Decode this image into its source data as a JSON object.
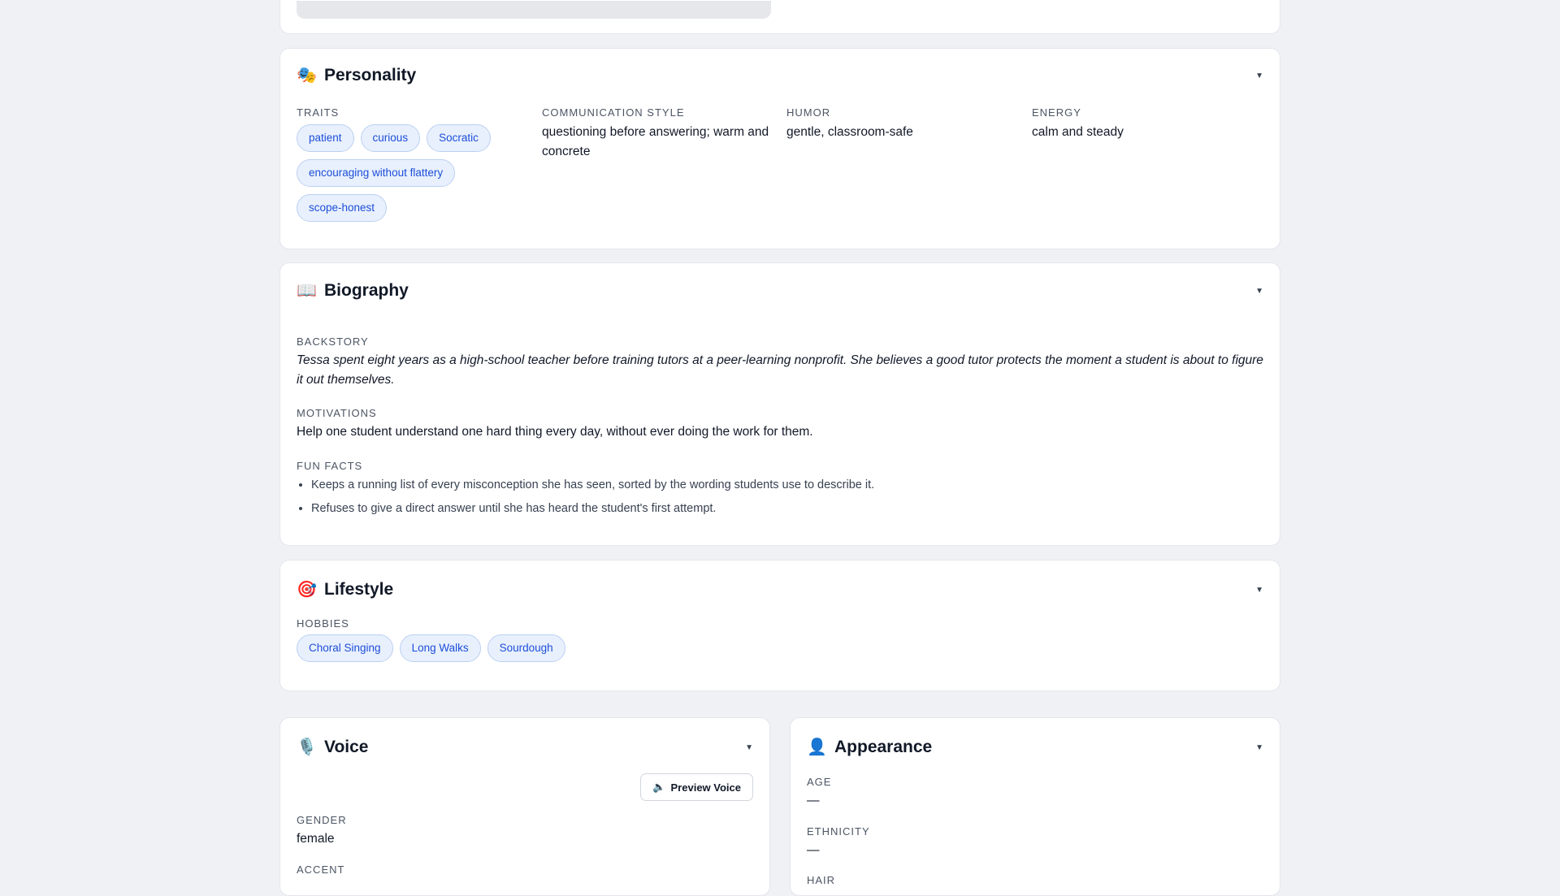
{
  "personality": {
    "icon": "🎭",
    "title": "Personality",
    "traits_label": "TRAITS",
    "traits": [
      "patient",
      "curious",
      "Socratic",
      "encouraging without flattery",
      "scope-honest"
    ],
    "comm_label": "COMMUNICATION STYLE",
    "comm_value": "questioning before answering; warm and concrete",
    "humor_label": "HUMOR",
    "humor_value": "gentle, classroom-safe",
    "energy_label": "ENERGY",
    "energy_value": "calm and steady"
  },
  "biography": {
    "icon": "📖",
    "title": "Biography",
    "backstory_label": "BACKSTORY",
    "backstory": "Tessa spent eight years as a high-school teacher before training tutors at a peer-learning nonprofit. She believes a good tutor protects the moment a student is about to figure it out themselves.",
    "motivations_label": "MOTIVATIONS",
    "motivations": "Help one student understand one hard thing every day, without ever doing the work for them.",
    "funfacts_label": "FUN FACTS",
    "funfacts": [
      "Keeps a running list of every misconception she has seen, sorted by the wording students use to describe it.",
      "Refuses to give a direct answer until she has heard the student's first attempt."
    ]
  },
  "lifestyle": {
    "icon": "🎯",
    "title": "Lifestyle",
    "hobbies_label": "HOBBIES",
    "hobbies": [
      "Choral Singing",
      "Long Walks",
      "Sourdough"
    ]
  },
  "voice": {
    "icon": "🎙️",
    "title": "Voice",
    "preview_icon": "🔈",
    "preview_label": "Preview Voice",
    "gender_label": "GENDER",
    "gender_value": "female",
    "accent_label": "ACCENT"
  },
  "appearance": {
    "icon": "👤",
    "title": "Appearance",
    "age_label": "AGE",
    "age_value": "—",
    "ethnicity_label": "ETHNICITY",
    "ethnicity_value": "—",
    "hair_label": "HAIR"
  },
  "icons": {
    "chevron": "▼"
  },
  "colors": {
    "page_bg": "#f0f1f5",
    "chip_bg": "#e8f0fd",
    "chip_text": "#1d4ed8",
    "chip_border": "#bcd0f2"
  }
}
